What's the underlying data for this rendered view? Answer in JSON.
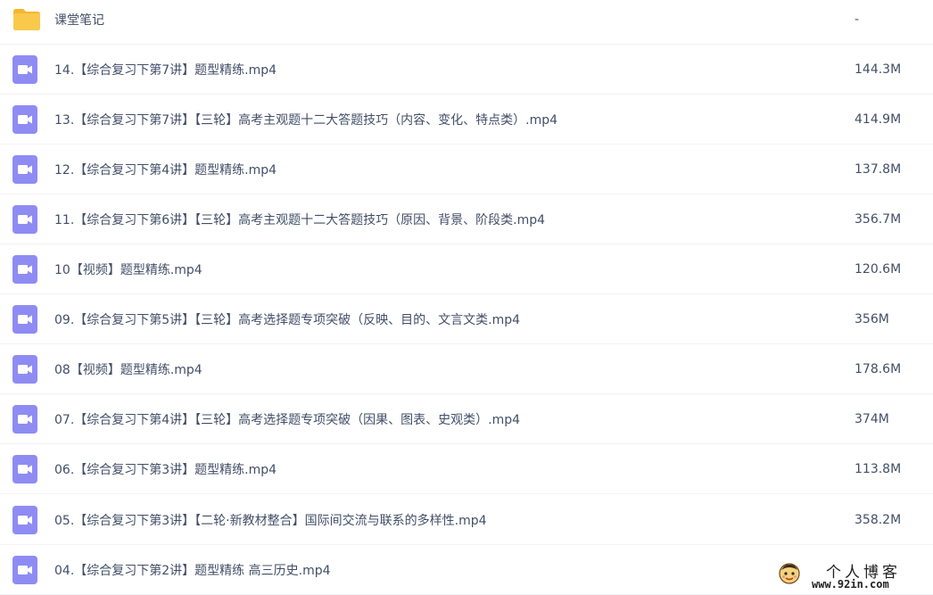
{
  "files": [
    {
      "name": "课堂笔记",
      "size": "-",
      "type": "folder",
      "icon": "folder-icon"
    },
    {
      "name": "14.【综合复习下第7讲】题型精练.mp4",
      "size": "144.3M",
      "type": "video",
      "icon": "video-icon"
    },
    {
      "name": "13.【综合复习下第7讲】【三轮】高考主观题十二大答题技巧（内容、变化、特点类）.mp4",
      "size": "414.9M",
      "type": "video",
      "icon": "video-icon"
    },
    {
      "name": "12.【综合复习下第4讲】题型精练.mp4",
      "size": "137.8M",
      "type": "video",
      "icon": "video-icon"
    },
    {
      "name": "11.【综合复习下第6讲】【三轮】高考主观题十二大答题技巧（原因、背景、阶段类.mp4",
      "size": "356.7M",
      "type": "video",
      "icon": "video-icon"
    },
    {
      "name": "10【视频】题型精练.mp4",
      "size": "120.6M",
      "type": "video",
      "icon": "video-icon"
    },
    {
      "name": "09.【综合复习下第5讲】【三轮】高考选择题专项突破（反映、目的、文言文类.mp4",
      "size": "356M",
      "type": "video",
      "icon": "video-icon"
    },
    {
      "name": "08【视频】题型精练.mp4",
      "size": "178.6M",
      "type": "video",
      "icon": "video-icon"
    },
    {
      "name": "07.【综合复习下第4讲】【三轮】高考选择题专项突破（因果、图表、史观类）.mp4",
      "size": "374M",
      "type": "video",
      "icon": "video-icon"
    },
    {
      "name": "06.【综合复习下第3讲】题型精练.mp4",
      "size": "113.8M",
      "type": "video",
      "icon": "video-icon"
    },
    {
      "name": "05.【综合复习下第3讲】【二轮·新教材整合】国际间交流与联系的多样性.mp4",
      "size": "358.2M",
      "type": "video",
      "icon": "video-icon"
    },
    {
      "name": "04.【综合复习下第2讲】题型精练 高三历史.mp4",
      "size": "",
      "type": "video",
      "icon": "video-icon"
    }
  ],
  "watermark": {
    "title": "个人博客",
    "domain": "www.92in.com",
    "icon": "mascot-logo"
  },
  "colors": {
    "folder": "#f8c94b",
    "folder_tab": "#f4b72c",
    "video": "#8e8cf3",
    "text": "#424e67",
    "divider": "#f1f2f4"
  }
}
